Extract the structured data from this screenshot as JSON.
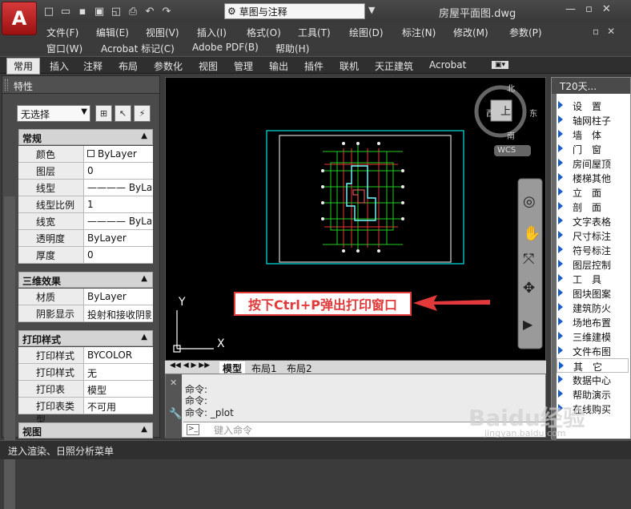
{
  "app": {
    "logo": "A",
    "window_title": "房屋平面图.dwg",
    "workspace": "草图与注释",
    "quick_access_icons": [
      "new-icon",
      "open-icon",
      "save-icon",
      "saveas-icon",
      "publish-icon",
      "plot-icon",
      "undo-icon",
      "redo-icon"
    ]
  },
  "menu": {
    "row1": [
      "文件(F)",
      "编辑(E)",
      "视图(V)",
      "插入(I)",
      "格式(O)",
      "工具(T)",
      "绘图(D)",
      "标注(N)",
      "修改(M)",
      "参数(P)"
    ],
    "row2": [
      "窗口(W)",
      "Acrobat 标记(C)",
      "Adobe PDF(B)",
      "帮助(H)"
    ]
  },
  "ribbon_tabs": [
    "常用",
    "插入",
    "注释",
    "布局",
    "参数化",
    "视图",
    "管理",
    "输出",
    "插件",
    "联机",
    "天正建筑",
    "Acrobat"
  ],
  "properties": {
    "title": "特性",
    "selection": "无选择",
    "sections": [
      {
        "name": "常规",
        "rows": [
          {
            "label": "颜色",
            "value": "ByLayer",
            "swatch": true
          },
          {
            "label": "图层",
            "value": "0"
          },
          {
            "label": "线型",
            "value": "———— ByLayer"
          },
          {
            "label": "线型比例",
            "value": "1"
          },
          {
            "label": "线宽",
            "value": "———— ByLayer"
          },
          {
            "label": "透明度",
            "value": "ByLayer"
          },
          {
            "label": "厚度",
            "value": "0"
          }
        ]
      },
      {
        "name": "三维效果",
        "rows": [
          {
            "label": "材质",
            "value": "ByLayer"
          },
          {
            "label": "阴影显示",
            "value": "投射和接收阴影"
          }
        ]
      },
      {
        "name": "打印样式",
        "rows": [
          {
            "label": "打印样式",
            "value": "BYCOLOR"
          },
          {
            "label": "打印样式表",
            "value": "无"
          },
          {
            "label": "打印表附...",
            "value": "模型"
          },
          {
            "label": "打印表类型",
            "value": "不可用"
          }
        ]
      },
      {
        "name": "视图",
        "rows": []
      }
    ]
  },
  "viewcube": {
    "north": "北",
    "south": "南",
    "east": "东",
    "west": "西",
    "face": "上",
    "wcs": "WCS"
  },
  "ucs": {
    "x": "X",
    "y": "Y"
  },
  "layout_tabs": [
    "模型",
    "布局1",
    "布局2"
  ],
  "command": {
    "history": [
      "命令:",
      "命令:",
      "命令: _plot"
    ],
    "placeholder": "键入命令"
  },
  "status": {
    "text": "进入渲染、日照分析菜单"
  },
  "t20": {
    "title": "T20天...",
    "items": [
      "设　置",
      "轴网柱子",
      "墙　体",
      "门　窗",
      "房间屋顶",
      "楼梯其他",
      "立　面",
      "剖　面",
      "文字表格",
      "尺寸标注",
      "符号标注",
      "图层控制",
      "工　具",
      "图块图案",
      "建筑防火",
      "场地布置",
      "三维建模",
      "文件布图",
      "其　它",
      "数据中心",
      "帮助演示",
      "在线购买"
    ]
  },
  "callout": {
    "text": "按下Ctrl+P弹出打印窗口"
  },
  "watermark": {
    "text": "Baidu经验",
    "sub": "jingyan.baidu.com"
  },
  "colors": {
    "accent": "#e23a3a",
    "wall_green": "#22cc22",
    "border_cyan": "#00e5e5",
    "t20_triangle": "#1a5cc8"
  }
}
